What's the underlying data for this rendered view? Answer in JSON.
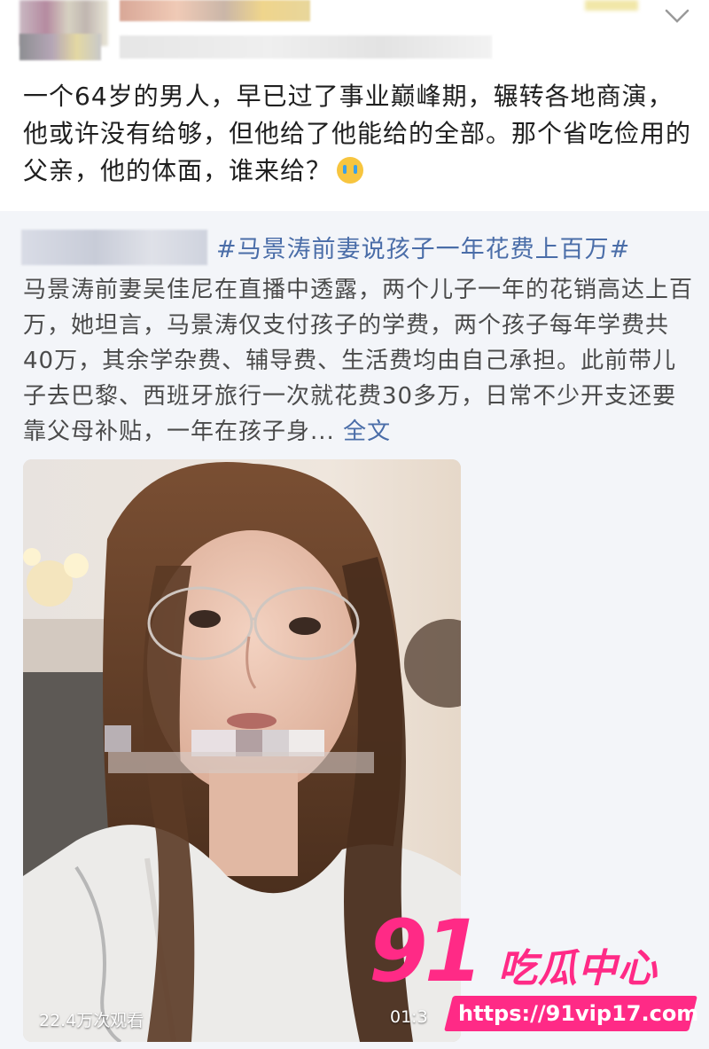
{
  "post": {
    "text": "一个64岁的男人，早已过了事业巅峰期，辗转各地商演，他或许没有给够，但他给了他能给的全部。那个省吃俭用的父亲，他的体面，谁来给？",
    "emoji": "crying-face"
  },
  "retweet": {
    "topic": "#马景涛前妻说孩子一年花费上百万#",
    "text": "马景涛前妻吴佳尼在直播中透露，两个儿子一年的花销高达上百万，她坦言，马景涛仅支付孩子的学费，两个孩子每年学费共40万，其余学杂费、辅导费、生活费均由自己承担。此前带儿子去巴黎、西班牙旅行一次就花费30多万，日常不少开支还要靠父母补贴，一年在孩子身...",
    "full_text_link": "全文"
  },
  "video": {
    "views": "22.4万次观看",
    "duration": "01:3"
  },
  "watermark": {
    "number": "91",
    "title": "吃瓜中心",
    "url": "https://91vip17.com"
  },
  "colors": {
    "link": "#4a6da8",
    "watermark": "#ff2a86",
    "background": "#f3f5f9"
  }
}
